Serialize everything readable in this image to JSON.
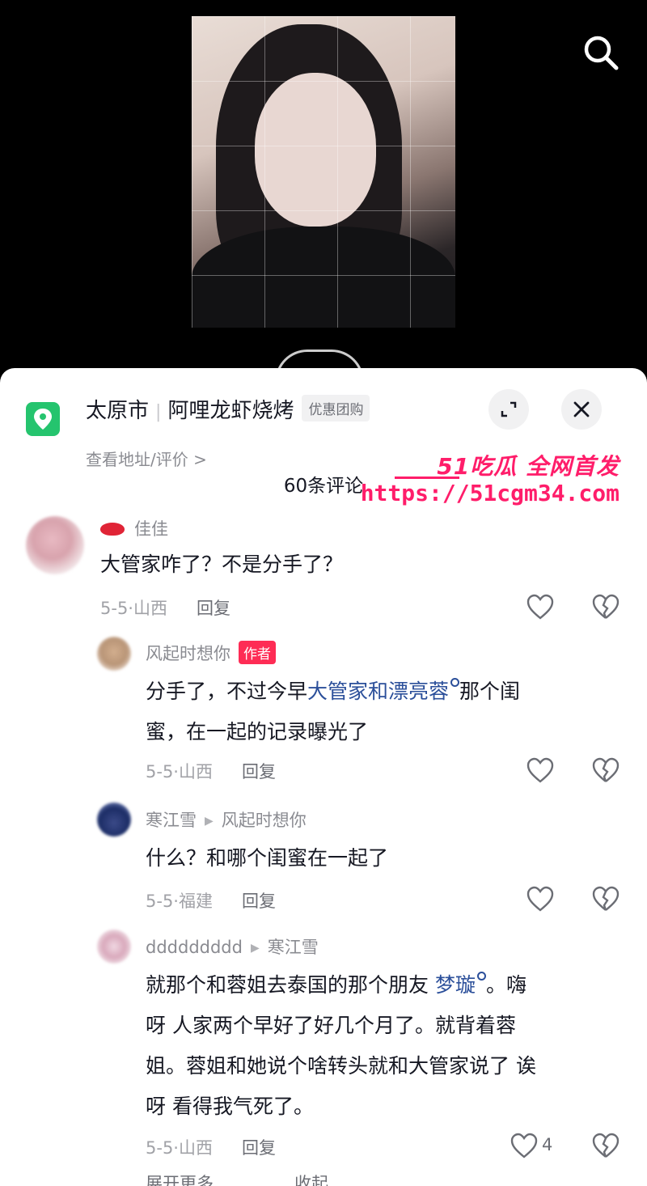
{
  "top": {
    "search_icon": "search-icon"
  },
  "location": {
    "city": "太原市",
    "shop": "阿哩龙虾烧烤",
    "tag": "优惠团购",
    "sub": "查看地址/评价 >"
  },
  "comments_header": {
    "count_label": "60条评论"
  },
  "promo": {
    "line1": "51吃瓜 全网首发",
    "line2": "https://51cgm34.com"
  },
  "comments": [
    {
      "name": "佳佳",
      "text": "大管家咋了？不是分手了？",
      "date": "5-5·",
      "region": "山西",
      "reply": "回复"
    },
    {
      "name": "风起时想你",
      "badge": "作者",
      "text_before": "分手了，不过今早",
      "link": "大管家和漂亮蓉",
      "text_after_line1": "那个闺",
      "text_line2": "蜜，在一起的记录曝光了",
      "date": "5-5·",
      "region": "山西",
      "reply": "回复"
    },
    {
      "name": "寒江雪",
      "reply_to": "风起时想你",
      "text": "什么？和哪个闺蜜在一起了",
      "date": "5-5·",
      "region": "福建",
      "reply": "回复"
    },
    {
      "name": "ddddddddd",
      "reply_to": "寒江雪",
      "text_line1_before": "就那个和蓉姐去泰国的那个朋友 ",
      "link": "梦璇",
      "text_line1_after": "。嗨",
      "text_line2": "呀 人家两个早好了好几个月了。就背着蓉",
      "text_line3": "姐。蓉姐和她说个啥转头就和大管家说了 诶",
      "text_line4": "呀 看得我气死了。",
      "date": "5-5·",
      "region": "山西",
      "reply": "回复",
      "likes": "4"
    }
  ],
  "bottom": {
    "expand_more": "展开更多",
    "collapse": "收起"
  },
  "colors": {
    "accent": "#fe2c55",
    "link": "#2b4f9a",
    "pin": "#25c46e",
    "promo": "#ff1d6a"
  }
}
